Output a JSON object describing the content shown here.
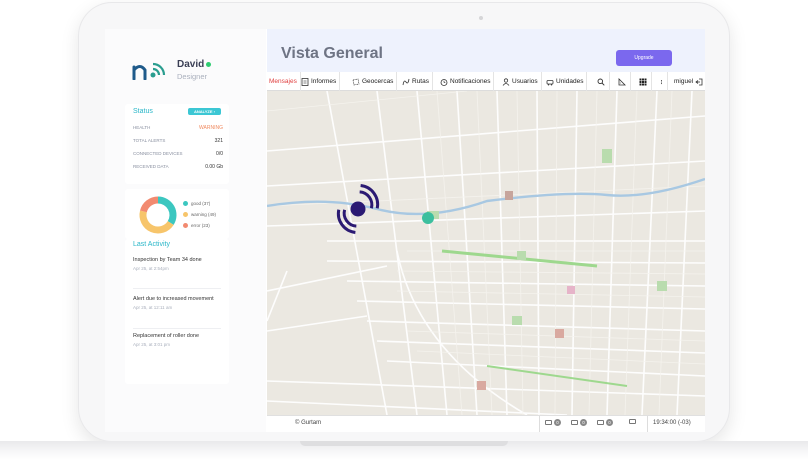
{
  "user": {
    "name": "David",
    "role": "Designer"
  },
  "status": {
    "title": "Status",
    "analyze_label": "ANALYZE",
    "rows": [
      {
        "label": "HEALTH",
        "value": "WARNING"
      },
      {
        "label": "TOTAL ALERTS",
        "value": "321"
      },
      {
        "label": "CONNECTED DEVICES",
        "value": "0/0"
      },
      {
        "label": "RECEIVED DATA",
        "value": "0.00 Gb"
      }
    ]
  },
  "chart_data": {
    "type": "pie",
    "categories": [
      "good",
      "warning",
      "error"
    ],
    "values": [
      37,
      49,
      23
    ],
    "legend": [
      {
        "label": "good (37)",
        "color": "#3cc7c0"
      },
      {
        "label": "warning (49)",
        "color": "#f7c56b"
      },
      {
        "label": "error (23)",
        "color": "#f28a70"
      }
    ]
  },
  "activity": {
    "title": "Last Activity",
    "items": [
      {
        "text": "Inspection by Team 34 done",
        "date": "Apr 25, at 2:54pm"
      },
      {
        "text": "Alert due to increased movement",
        "date": "Apr 25, at 12:11 am"
      },
      {
        "text": "Replacement of roller done",
        "date": "Apr 25, at 3:01 pm"
      }
    ]
  },
  "header": {
    "title": "Vista General",
    "upgrade_label": "Upgrade"
  },
  "toolbar": {
    "items": [
      {
        "label": "Mensajes",
        "icon": "none"
      },
      {
        "label": "Informes",
        "icon": "report-icon"
      },
      {
        "label": "Geocercas",
        "icon": "geofence-icon"
      },
      {
        "label": "Rutas",
        "icon": "route-icon"
      },
      {
        "label": "Notificaciones",
        "icon": "alarm-clock-icon"
      },
      {
        "label": "Usuarios",
        "icon": "user-icon"
      },
      {
        "label": "Unidades",
        "icon": "car-icon"
      }
    ],
    "user": "miguel"
  },
  "footer": {
    "copyright": "© Gurtam",
    "badge1": "0",
    "badge2": "0",
    "badge3": "0",
    "time": "19:34:00 (-03)"
  },
  "colors": {
    "accent": "#7b68ee",
    "teal": "#29b6c8",
    "brand": "#1e2a78"
  }
}
